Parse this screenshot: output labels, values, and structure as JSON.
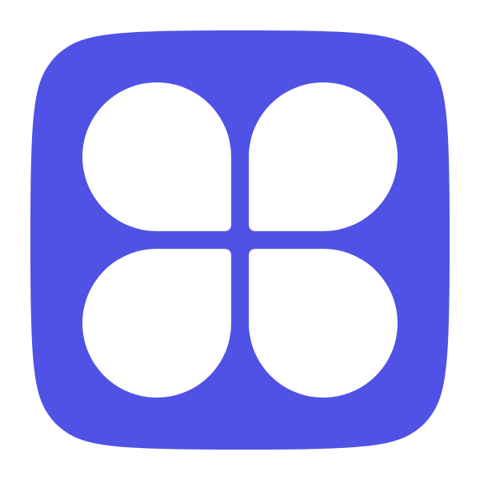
{
  "icon": {
    "name": "four-leaf-clover-app-icon",
    "glyph": "clover-icon",
    "colors": {
      "background": "#4f52e4",
      "petal": "#ffffff",
      "page": "#ffffff"
    }
  }
}
